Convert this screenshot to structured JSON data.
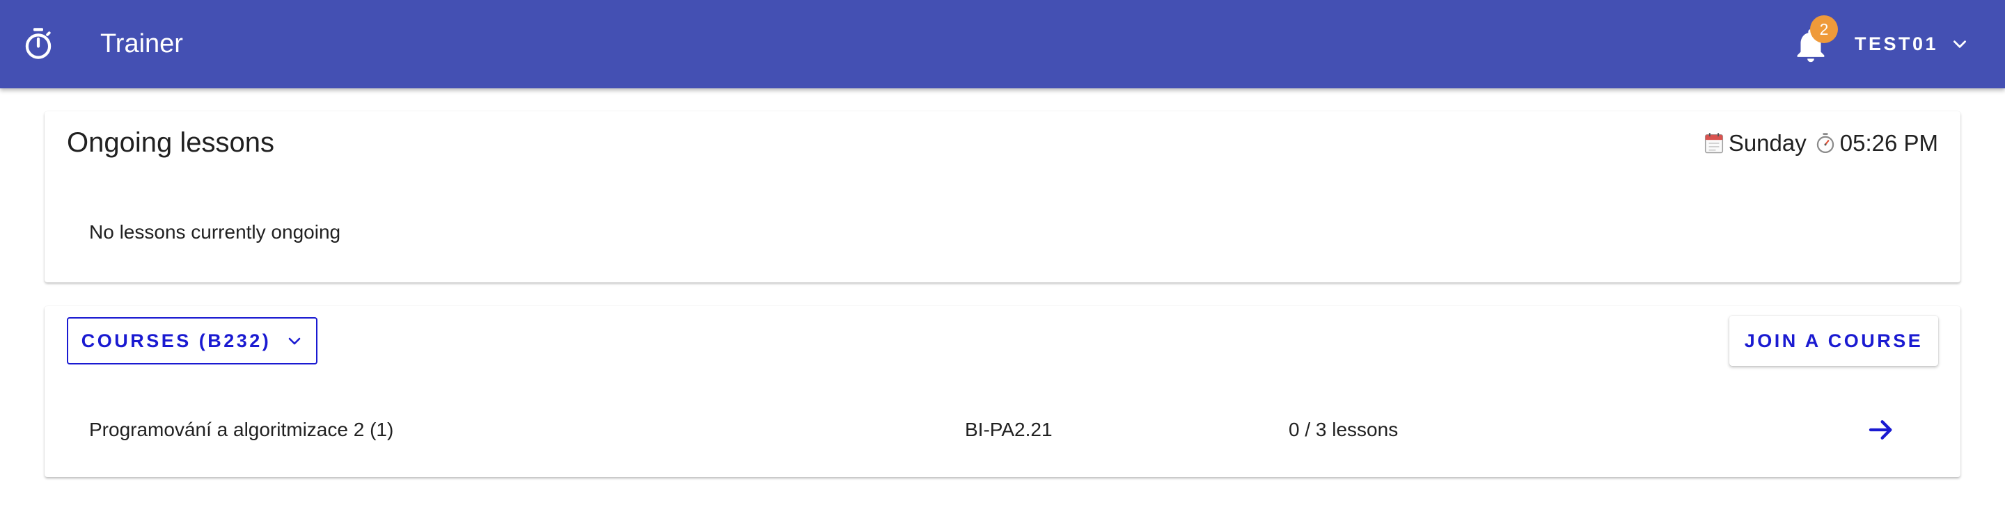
{
  "colors": {
    "appbar": "#4450b3",
    "accent": "#1a1ad1",
    "badge": "#ef9a3a",
    "text": "#212121"
  },
  "header": {
    "logo_icon": "stopwatch-icon",
    "title": "Trainer",
    "notifications": {
      "icon": "bell-icon",
      "count": "2"
    },
    "user": {
      "name": "TEST01",
      "icon": "chevron-down-icon"
    }
  },
  "ongoing": {
    "title": "Ongoing lessons",
    "calendar_icon": "calendar-icon",
    "day": "Sunday",
    "clock_icon": "stopwatch-icon",
    "time": "05:26 PM",
    "empty_message": "No lessons currently ongoing"
  },
  "courses": {
    "dropdown_label": "COURSES (B232)",
    "dropdown_icon": "chevron-down-icon",
    "join_label": "JOIN A COURSE",
    "items": [
      {
        "name": "Programování a algoritmizace 2 (1)",
        "code": "BI-PA2.21",
        "lessons": "0 / 3 lessons",
        "action_icon": "arrow-right-icon"
      }
    ]
  }
}
